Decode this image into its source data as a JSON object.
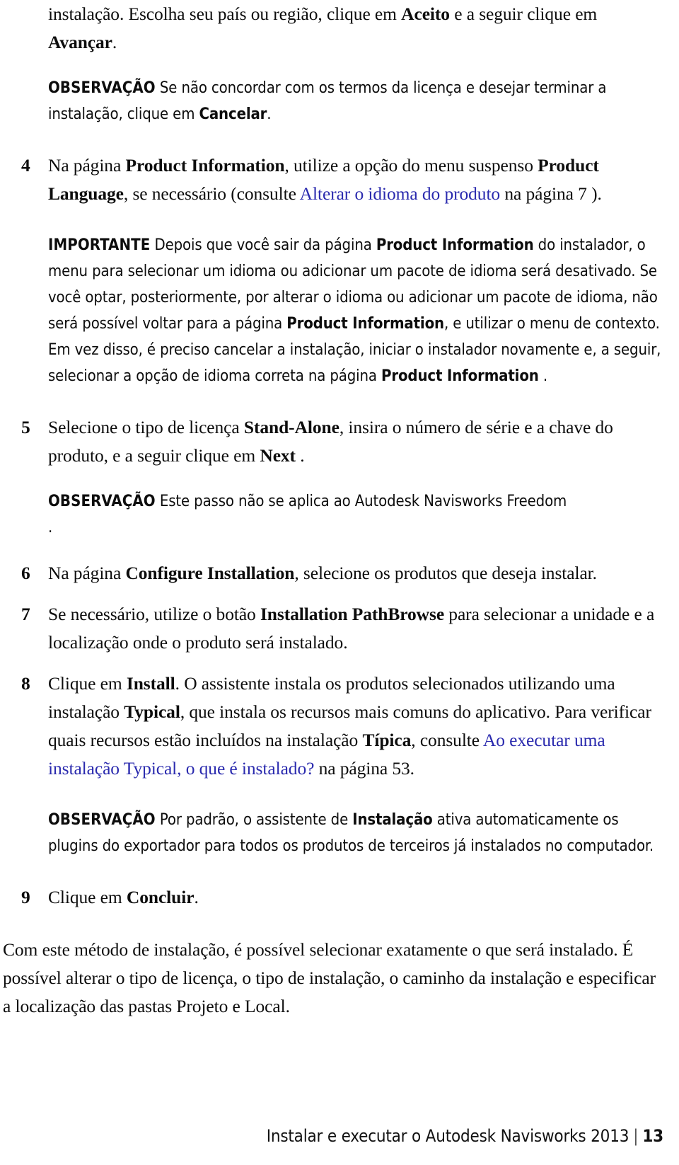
{
  "document": {
    "language": "pt-BR",
    "link_color": "#2a2aae",
    "text_color": "#0d0d0d",
    "background_color": "#ffffff"
  },
  "lead_paragraph": {
    "part1": "instalação. Escolha seu país ou região, clique em ",
    "bold1": "Aceito",
    "part2": " e a seguir clique em ",
    "bold2": "Avançar",
    "part3": "."
  },
  "note_1": {
    "label": "OBSERVAÇÃO",
    "part1": " Se não concordar com os termos da licença e desejar terminar a instalação, clique em ",
    "bold1": "Cancelar",
    "part2": "."
  },
  "steps": [
    {
      "number": "4",
      "part1": "Na página ",
      "bold1": "Product Information",
      "part2": ", utilize a opção do menu suspenso ",
      "bold2": "Product Language",
      "part3": ", se necessário (consulte ",
      "link": "Alterar o idioma do produto",
      "part4": " na página 7 )."
    },
    {
      "number": "5",
      "part1": "Selecione o tipo de licença ",
      "bold1": "Stand-Alone",
      "part2": ", insira o número de série e a chave do produto, e a seguir clique em ",
      "bold2": "Next",
      "part3": " ."
    },
    {
      "number": "6",
      "part1": "Na página ",
      "bold1": "Configure Installation",
      "part2": ", selecione os produtos que deseja instalar."
    },
    {
      "number": "7",
      "part1": "Se necessário, utilize o botão ",
      "bold1": "Installation PathBrowse",
      "part2": " para selecionar a unidade e a localização onde o produto será instalado."
    },
    {
      "number": "8",
      "part1": "Clique em ",
      "bold1": "Install",
      "part2": ". O assistente instala os produtos selecionados utilizando uma instalação ",
      "bold2": "Typical",
      "part3": ", que instala os recursos mais comuns do aplicativo. Para verificar quais recursos estão incluídos na instalação ",
      "bold3": "Típica",
      "part4": ", consulte ",
      "link": "Ao executar uma instalação Typical, o que é instalado?",
      "part5": " na página 53."
    },
    {
      "number": "9",
      "part1": "Clique em ",
      "bold1": "Concluir",
      "part2": "."
    }
  ],
  "note_important": {
    "label": "IMPORTANTE",
    "part1": " Depois que você sair da página ",
    "bold1": "Product Information",
    "part2": " do instalador, o menu para selecionar um idioma ou adicionar um pacote de idioma será desativado. Se você optar, posteriormente, por alterar o idioma ou adicionar um pacote de idioma, não será possível voltar para a página ",
    "bold2": "Product Information",
    "part3": ", e utilizar o menu de contexto. Em vez disso, é preciso cancelar a instalação, iniciar o instalador novamente e, a seguir, selecionar a opção de idioma correta na página ",
    "bold3": "Product Information",
    "part4": " ."
  },
  "note_2": {
    "label": "OBSERVAÇÃO",
    "part1": " Este passo não se aplica ao  Autodesk Navisworks Freedom",
    "part2": "."
  },
  "note_3": {
    "label": "OBSERVAÇÃO",
    "part1": " Por padrão, o assistente de ",
    "bold1": "Instalação",
    "part2": " ativa automaticamente os plugins do exportador para todos os produtos de terceiros já instalados no computador."
  },
  "closing_paragraph": {
    "text": "Com este método de instalação, é possível selecionar exatamente o que será instalado. É possível alterar o tipo de licença, o tipo de instalação, o caminho da instalação e especificar a localização das pastas Projeto e Local."
  },
  "footer": {
    "title": "Instalar e executar o Autodesk Navisworks 2013",
    "separator": "|",
    "page_number": "13"
  }
}
